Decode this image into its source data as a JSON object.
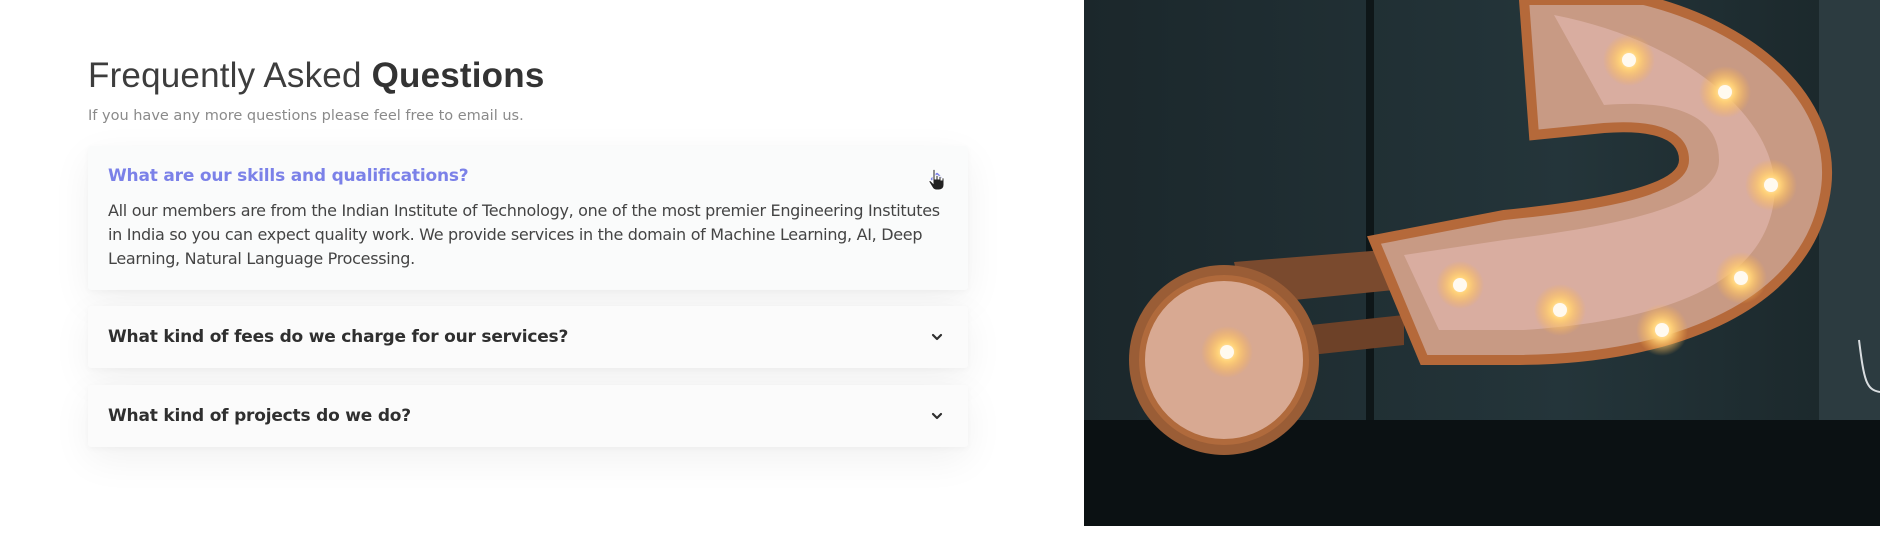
{
  "heading": {
    "light": "Frequently Asked ",
    "bold": "Questions"
  },
  "subtitle": "If you have any more questions please feel free to email us.",
  "faqs": [
    {
      "question": "What are our skills and qualifications?",
      "answer": "All our members are from the Indian Institute of Technology, one of the most premier Engineering Institutes in India so you can expect quality work. We provide services in the domain of Machine Learning, AI, Deep Learning, Natural Language Processing.",
      "expanded": true
    },
    {
      "question": "What kind of fees do we charge for our services?",
      "expanded": false
    },
    {
      "question": "What kind of projects do we do?",
      "expanded": false
    }
  ],
  "colors": {
    "accent": "#7b81e8",
    "text": "#2f2f2f",
    "muted": "#8a8a8a"
  },
  "icons": [
    "chevron-up-icon",
    "chevron-down-icon",
    "hand-cursor-icon"
  ]
}
